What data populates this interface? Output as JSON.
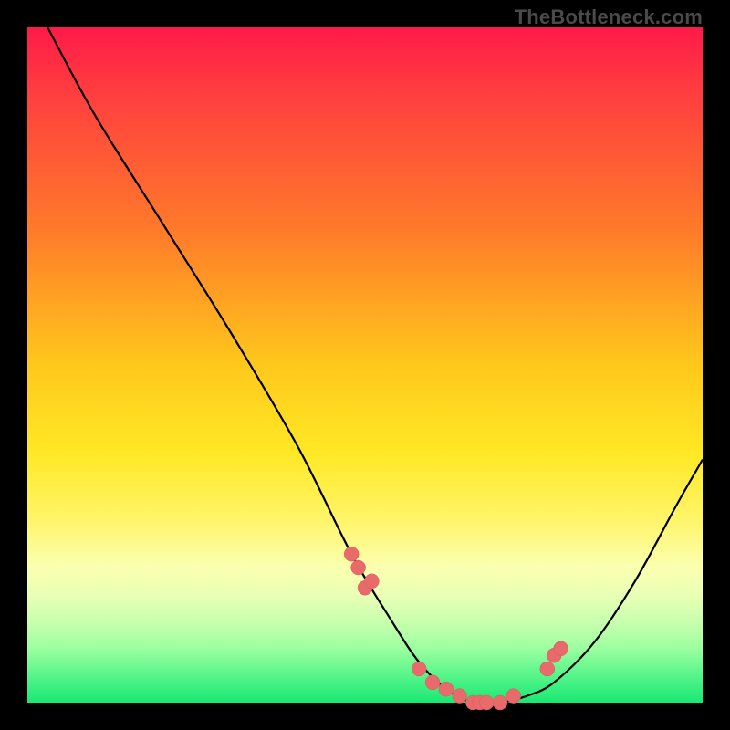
{
  "watermark": "TheBottleneck.com",
  "chart_data": {
    "type": "line",
    "title": "",
    "xlabel": "",
    "ylabel": "",
    "xlim": [
      0,
      100
    ],
    "ylim": [
      0,
      100
    ],
    "grid": false,
    "background_gradient": {
      "top_color": "#ff1a49",
      "bottom_color": "#18e873",
      "description": "bottleneck severity gradient (red=high, green=low)"
    },
    "series": [
      {
        "name": "bottleneck-curve",
        "x": [
          3,
          10,
          20,
          30,
          40,
          48,
          54,
          58,
          62,
          66,
          70,
          74,
          78,
          84,
          90,
          96,
          100
        ],
        "values": [
          100,
          87,
          71,
          55,
          38,
          22,
          12,
          6,
          2,
          0,
          0,
          1,
          3,
          9,
          18,
          29,
          36
        ]
      }
    ],
    "points": {
      "name": "benchmark-dots",
      "x": [
        48,
        49,
        50,
        51,
        58,
        60,
        62,
        64,
        66,
        67,
        68,
        70,
        72,
        77,
        78,
        79
      ],
      "values": [
        22,
        20,
        17,
        18,
        5,
        3,
        2,
        1,
        0,
        0,
        0,
        0,
        1,
        5,
        7,
        8
      ]
    }
  }
}
